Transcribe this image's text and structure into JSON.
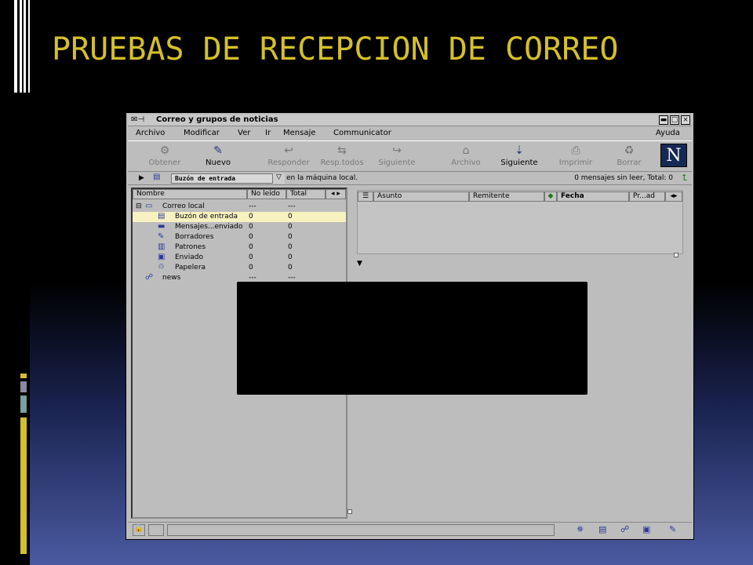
{
  "slide": {
    "title": "PRUEBAS DE RECEPCION DE CORREO",
    "title_color": "#d4c02a"
  },
  "window": {
    "title": "Correo y grupos de noticias",
    "buttons": {
      "minimize": "▬",
      "maximize": "□",
      "close": "×"
    },
    "menu": [
      "Archivo",
      "Modificar",
      "Ver",
      "Ir",
      "Mensaje",
      "Communicator",
      "Ayuda"
    ],
    "toolbar": [
      {
        "label": "Obtener",
        "icon": "get-mail-icon",
        "enabled": false
      },
      {
        "label": "Nuevo",
        "icon": "new-message-icon",
        "enabled": true
      },
      {
        "label": "Responder",
        "icon": "reply-icon",
        "enabled": false
      },
      {
        "label": "Resp.todos",
        "icon": "reply-all-icon",
        "enabled": false
      },
      {
        "label": "Siguiente",
        "icon": "forward-icon",
        "enabled": false
      },
      {
        "label": "Archivo",
        "icon": "file-icon",
        "enabled": false
      },
      {
        "label": "Siguiente",
        "icon": "next-icon",
        "enabled": true
      },
      {
        "label": "Imprimir",
        "icon": "print-icon",
        "enabled": false
      },
      {
        "label": "Borrar",
        "icon": "delete-icon",
        "enabled": false
      }
    ],
    "logo": "N",
    "location": {
      "folder": "Buzón de entrada",
      "suffix": "en la máquina local.",
      "counts": "0 mensajes sin leer, Total: 0"
    },
    "folders_header": {
      "name": "Nombre",
      "unread": "No leído",
      "total": "Total"
    },
    "folders": [
      {
        "name": "Correo local",
        "unread": "---",
        "total": "---",
        "level": 0,
        "selected": false
      },
      {
        "name": "Buzón de entrada",
        "unread": "0",
        "total": "0",
        "level": 1,
        "selected": true
      },
      {
        "name": "Mensajes...enviado",
        "unread": "0",
        "total": "0",
        "level": 1,
        "selected": false
      },
      {
        "name": "Borradores",
        "unread": "0",
        "total": "0",
        "level": 1,
        "selected": false
      },
      {
        "name": "Patrones",
        "unread": "0",
        "total": "0",
        "level": 1,
        "selected": false
      },
      {
        "name": "Enviado",
        "unread": "0",
        "total": "0",
        "level": 1,
        "selected": false
      },
      {
        "name": "Papelera",
        "unread": "0",
        "total": "0",
        "level": 1,
        "selected": false
      },
      {
        "name": "news",
        "unread": "---",
        "total": "---",
        "level": 0,
        "selected": false
      }
    ],
    "messages_header": {
      "subject": "Asunto",
      "sender": "Remitente",
      "date": "Fecha",
      "priority": "Pr...ad"
    }
  }
}
